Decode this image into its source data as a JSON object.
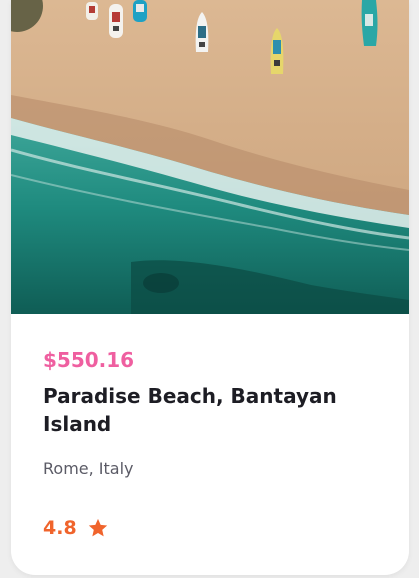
{
  "listing": {
    "price": "$550.16",
    "title": "Paradise Beach, Bantayan Island",
    "location": "Rome, Italy",
    "rating": "4.8",
    "rating_icon": "star-icon",
    "image_description_icon": "beach-photo"
  },
  "colors": {
    "price": "#ef5fa0",
    "rating": "#f0642c",
    "title": "#1d1d24",
    "location": "#5b5b66",
    "sand": "#d8b48f",
    "sea": "#1e8a80"
  }
}
